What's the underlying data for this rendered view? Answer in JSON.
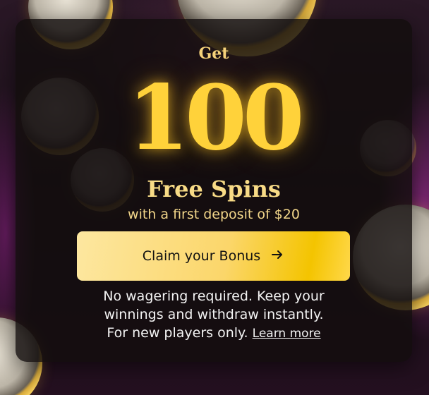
{
  "promo": {
    "get_label": "Get",
    "amount": "100",
    "spins_label": "Free Spins",
    "deposit_text": "with a first deposit of $20"
  },
  "cta": {
    "label": "Claim your Bonus",
    "icon": "arrow-right-icon"
  },
  "terms": {
    "line1": "No wagering required. Keep your",
    "line2": "winnings and withdraw instantly.",
    "line3": "For new players only.",
    "learn_more": "Learn more"
  },
  "colors": {
    "accent": "#ffd23a",
    "button_start": "#fde7a0",
    "button_end": "#f4c400",
    "card_bg": "#120e0e"
  }
}
